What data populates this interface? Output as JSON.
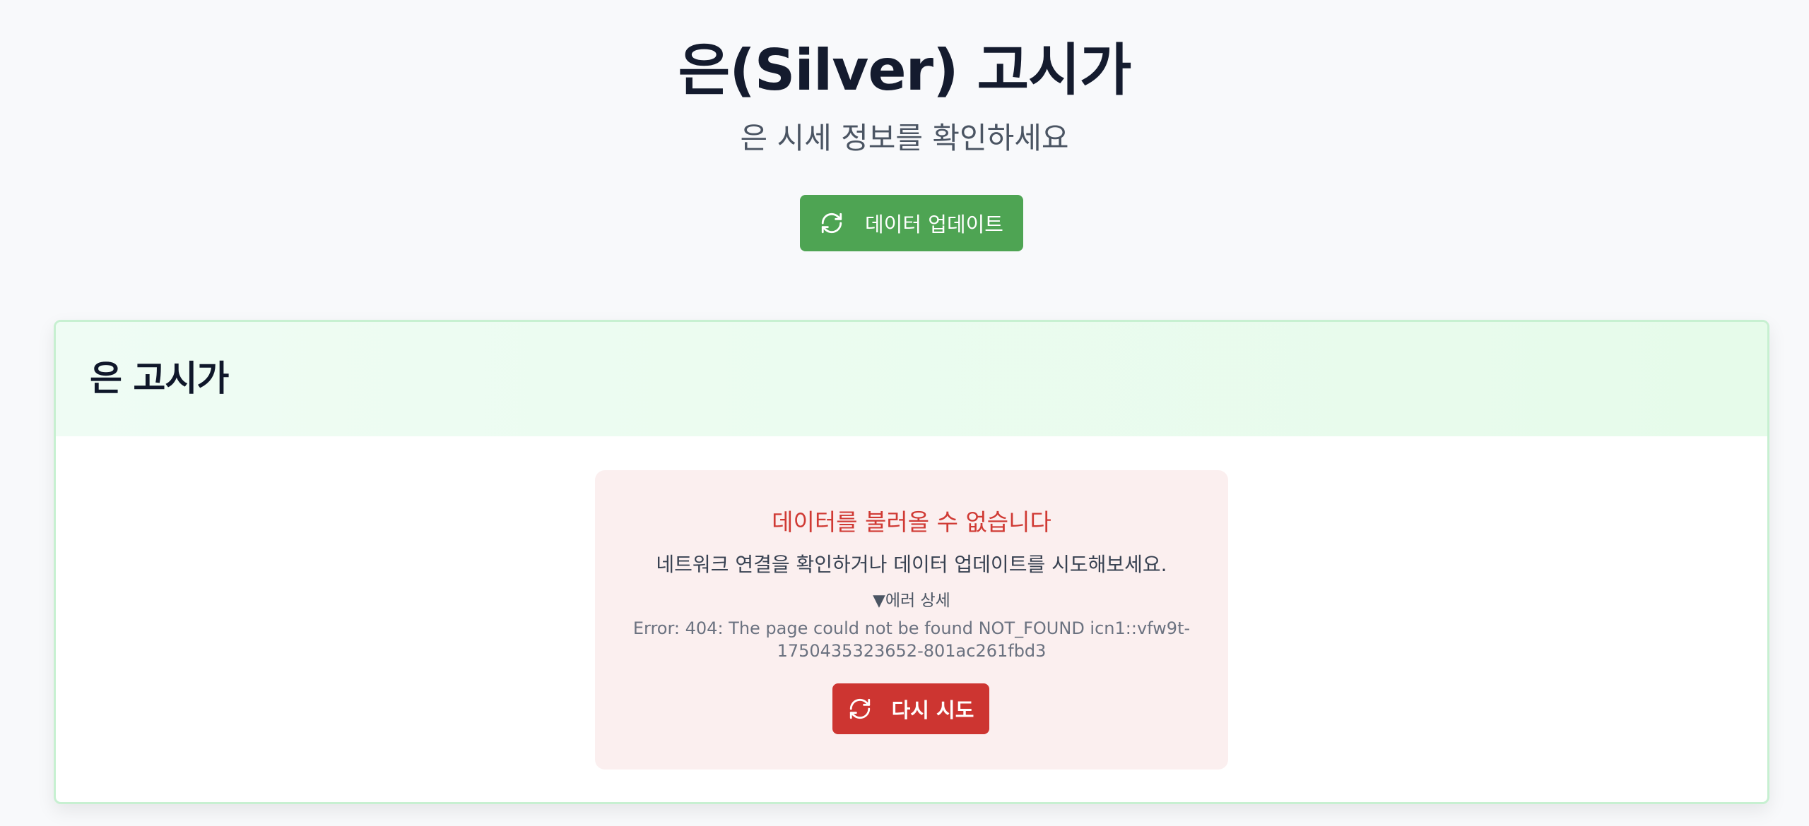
{
  "header": {
    "title": "은(Silver) 고시가",
    "subtitle": "은 시세 정보를 확인하세요",
    "update_button": {
      "icon": "refresh-icon",
      "label": "데이터 업데이트"
    }
  },
  "card": {
    "title": "은 고시가",
    "error": {
      "title": "데이터를 불러올 수 없습니다",
      "message": "네트워크 연결을 확인하거나 데이터 업데이트를 시도해보세요.",
      "details_toggle": "▼에러 상세",
      "details_text": "Error: 404: The page could not be found NOT_FOUND icn1::vfw9t-1750435323652-801ac261fbd3",
      "retry_button": {
        "icon": "refresh-icon",
        "label": "다시 시도"
      }
    }
  },
  "colors": {
    "update_button": "#4ea453",
    "retry_button": "#cd3531",
    "error_title": "#d03a34",
    "card_border": "#c7f0d1",
    "card_header_bg": "#e6fbea",
    "error_box_bg": "#fbefef"
  }
}
